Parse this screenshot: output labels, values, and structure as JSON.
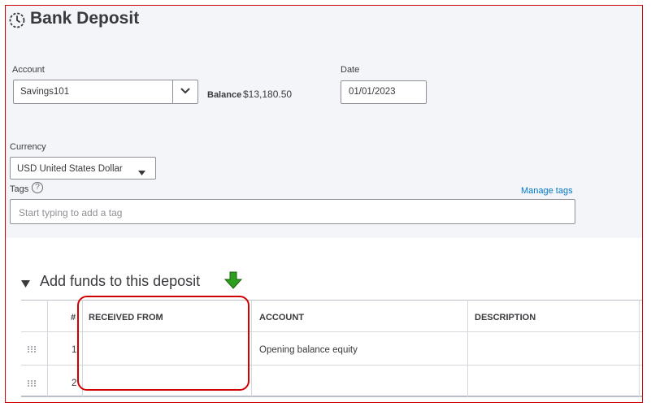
{
  "header": {
    "title": "Bank Deposit"
  },
  "account": {
    "label": "Account",
    "value": "Savings101"
  },
  "balance": {
    "label": "Balance",
    "value": "$13,180.50"
  },
  "date": {
    "label": "Date",
    "value": "01/01/2023"
  },
  "currency": {
    "label": "Currency",
    "value": "USD United States Dollar"
  },
  "tags": {
    "label": "Tags",
    "help": "?",
    "manage_link": "Manage tags",
    "placeholder": "Start typing to add a tag"
  },
  "funds": {
    "title": "Add funds to this deposit",
    "columns": [
      "#",
      "RECEIVED FROM",
      "ACCOUNT",
      "DESCRIPTION"
    ],
    "rows": [
      {
        "num": "1",
        "received_from": "",
        "account": "Opening balance equity",
        "description": ""
      },
      {
        "num": "2",
        "received_from": "",
        "account": "",
        "description": ""
      }
    ]
  },
  "colors": {
    "accent_link": "#0077c5",
    "annotation_red": "#d10000",
    "annotation_arrow": "#2ca01c"
  },
  "icons": [
    "history-icon",
    "chevron-down-icon",
    "caret-down-icon",
    "help-icon",
    "triangle-down-icon",
    "green-arrow-down-icon",
    "drag-handle-icon"
  ]
}
